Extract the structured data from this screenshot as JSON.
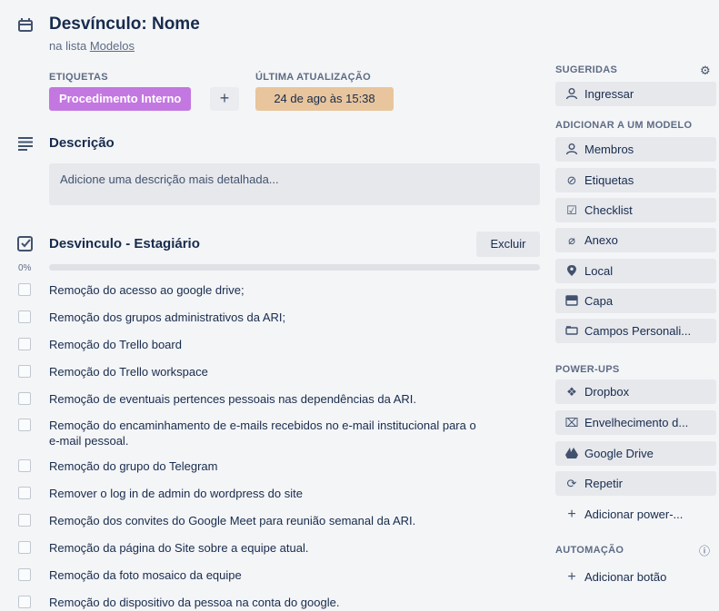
{
  "header": {
    "title": "Desvínculo: Nome",
    "list_prefix": "na lista",
    "list_name": "Modelos"
  },
  "labels_section": {
    "etiquetas_label": "ETIQUETAS",
    "ultima_label": "ÚLTIMA ATUALIZAÇÃO",
    "label_chip": "Procedimento Interno",
    "label_color": "#c377e0",
    "add_symbol": "+",
    "date": "24 de ago às 15:38"
  },
  "description": {
    "title": "Descrição",
    "placeholder": "Adicione uma descrição mais detalhada..."
  },
  "checklist": {
    "title": "Desvinculo - Estagiário",
    "delete_label": "Excluir",
    "percent": "0%",
    "progress": 0,
    "items": [
      "Remoção do acesso ao google drive;",
      "Remoção dos grupos administrativos da ARI;",
      "Remoção do Trello board",
      "Remoção do Trello workspace",
      "Remoção de eventuais pertences pessoais nas dependências da ARI.",
      "Remoção do encaminhamento de e-mails recebidos no e-mail institucional para o e-mail pessoal.",
      "Remoção do grupo do Telegram",
      "Remover o log in de admin do wordpress do site",
      "Remoção dos convites do Google Meet para reunião semanal da ARI.",
      "Remoção da página do Site sobre a equipe atual.",
      "Remoção da foto mosaico da equipe",
      "Remoção do dispositivo da pessoa na conta do google."
    ]
  },
  "sidebar": {
    "sugeridas_label": "SUGERIDAS",
    "ingressar": "Ingressar",
    "adicionar_label": "ADICIONAR A UM MODELO",
    "add_items": [
      "Membros",
      "Etiquetas",
      "Checklist",
      "Anexo",
      "Local",
      "Capa",
      "Campos Personali..."
    ],
    "powerups_label": "POWER-UPS",
    "powerups": [
      "Dropbox",
      "Envelhecimento d...",
      "Google Drive",
      "Repetir",
      "Adicionar power-..."
    ],
    "automacao_label": "AUTOMAÇÃO",
    "add_button": "Adicionar botão"
  },
  "icons": {
    "header": "card-icon",
    "description": "lines-icon",
    "checklist": "checkbox-icon",
    "ingressar": "person-icon",
    "membros": "person-icon",
    "etiquetas": "tag-icon",
    "checklist_btn": "checklist-icon",
    "anexo": "paperclip-icon",
    "local": "pin-icon",
    "capa": "cover-icon",
    "campos": "fields-icon",
    "dropbox": "dropbox-icon",
    "envelhecimento": "aging-icon",
    "google_drive": "drive-icon",
    "repetir": "repeat-icon",
    "plus": "plus-icon",
    "gear": "gear-icon",
    "info": "info-icon"
  }
}
